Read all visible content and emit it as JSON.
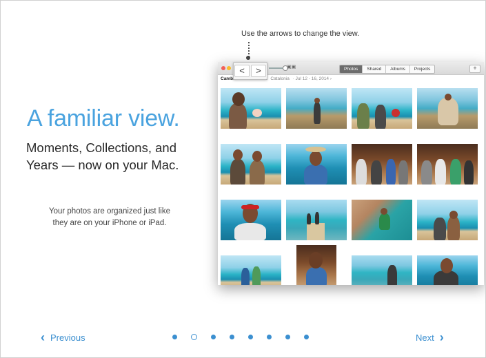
{
  "slide": {
    "headline": "A familiar view.",
    "subhead": "Moments, Collections, and Years — now on your Mac.",
    "body": "Your photos are organized just like they are on your iPhone or iPad.",
    "tip": "Use the arrows to change the view."
  },
  "photos_window": {
    "nav_back": "<",
    "nav_forward": ">",
    "tabs": [
      {
        "label": "Photos",
        "active": true
      },
      {
        "label": "Shared",
        "active": false
      },
      {
        "label": "Albums",
        "active": false
      },
      {
        "label": "Projects",
        "active": false
      }
    ],
    "add_label": "+",
    "breadcrumb": {
      "title": "Cambrils & Barcelona",
      "place": "Catalonia",
      "dates": "· Jul 12 - 16, 2014 ›"
    }
  },
  "footer": {
    "previous": "Previous",
    "next": "Next",
    "page_count": 8,
    "current_page": 2
  },
  "colors": {
    "accent": "#3b8fd0",
    "headline": "#4aa3df"
  },
  "icons": {
    "previous": "chevron-left-icon",
    "next": "chevron-right-icon"
  }
}
